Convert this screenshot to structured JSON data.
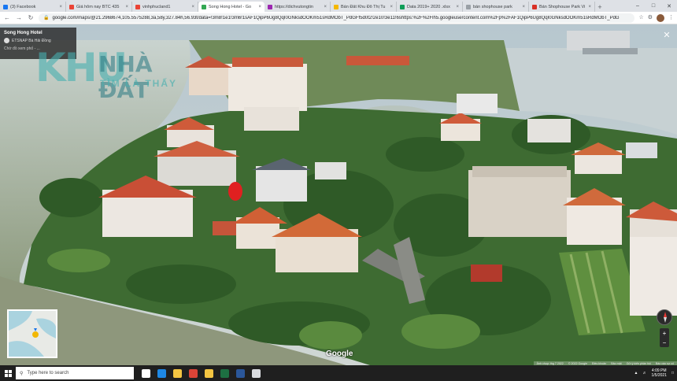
{
  "browser": {
    "tabs": [
      {
        "title": "(3) Facebook",
        "color": "#1877f2",
        "active": false
      },
      {
        "title": "Giá hôm nay BTC 435",
        "color": "#ea4335",
        "active": false
      },
      {
        "title": "vinhphucland1",
        "color": "#ea4335",
        "active": false
      },
      {
        "title": "Song Hong Hotel - Go",
        "color": "#34a853",
        "active": true
      },
      {
        "title": "https://dichvutongtin",
        "color": "#9c27b0",
        "active": false
      },
      {
        "title": "Bán Đất Khu Đô Thị Tu",
        "color": "#f5b800",
        "active": false
      },
      {
        "title": "Data 2019+ 2020 .xlsx",
        "color": "#0f9d58",
        "active": false
      },
      {
        "title": "bán shophouse park",
        "color": "#9aa0a6",
        "active": false
      },
      {
        "title": "Bán Shophouse Park Vi",
        "color": "#d93025",
        "active": false
      }
    ],
    "newtab_label": "+",
    "url": "google.com/maps/@21.2968674,105.5575288,3a,58y,327.84h,56.93t/data=!3m8!1e1!3m6!1sAF1QipP6Ug8QqI0GNksdOOKm51sRdMObT_PdGFf5d0t2!2e10!3e11!6shttps:%2F%2Flh5.googleusercontent.com%2Fp%2FAF1QipP6Ug8QqI0GNksdOOKm51sRdMObT_PdG"
  },
  "infocard": {
    "name": "Song Hong Hotel",
    "address": "ETSNAP Bà Hải Đồng",
    "date": "Chờ đồ xem phố - ..."
  },
  "watermark": {
    "khu": "KHU",
    "nhadat": "NHÀ ĐẤT",
    "tim": "TÌM LÀ THẤY"
  },
  "map": {
    "close_label": "✕",
    "google_logo": "Google",
    "zoom_in": "+",
    "zoom_out": "−",
    "footer": [
      "Ảnh chụp: thg 7 2022",
      "© 2022 Google",
      "Điều khoản",
      "Bảo mật",
      "Gửi ý kiến phản hồi",
      "Báo cáo sự cố"
    ]
  },
  "taskbar": {
    "search_placeholder": "Type here to search",
    "time": "4:09 PM",
    "date": "1/5/2021",
    "apps": [
      {
        "name": "task-view",
        "color": "#ffffff"
      },
      {
        "name": "edge",
        "color": "#1e88e5"
      },
      {
        "name": "explorer",
        "color": "#f4c542"
      },
      {
        "name": "chrome",
        "color": "#db4437"
      },
      {
        "name": "mail",
        "color": "#f4c542"
      },
      {
        "name": "excel",
        "color": "#1d6f42"
      },
      {
        "name": "word",
        "color": "#2b579a"
      },
      {
        "name": "store",
        "color": "#dadce0"
      }
    ]
  }
}
